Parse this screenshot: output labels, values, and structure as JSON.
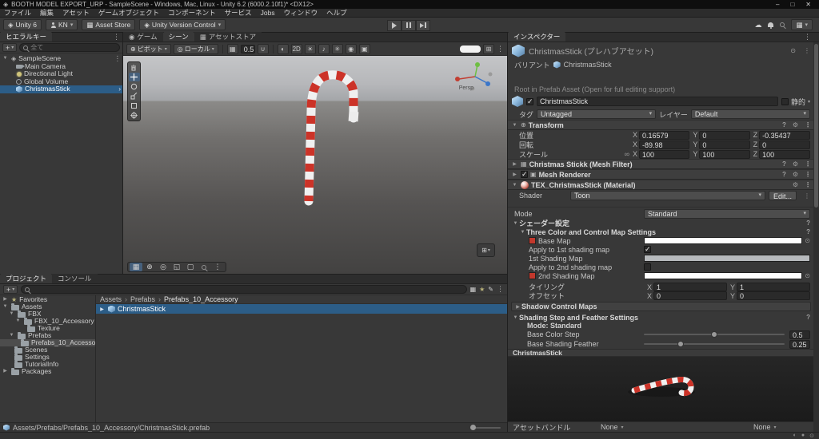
{
  "titlebar": {
    "title": "BOOTH MODEL EXPORT_URP - SampleScene - Windows, Mac, Linux - Unity 6.2 (6000.2.10f1)* <DX12>",
    "minimize": "–",
    "maximize": "□",
    "close": "✕"
  },
  "menubar": {
    "items": [
      "ファイル",
      "編集",
      "アセット",
      "ゲームオブジェクト",
      "コンポーネント",
      "サービス",
      "Jobs",
      "ウィンドウ",
      "ヘルプ"
    ]
  },
  "toolbar": {
    "unity_badge": "Unity 6",
    "account": "KN",
    "asset_store": "Asset Store",
    "version_control": "Unity Version Control"
  },
  "axes": [
    "X",
    "Y",
    "Z"
  ],
  "hierarchy": {
    "tab": "ヒエラルキー",
    "search_placeholder": "全て",
    "scene_name": "SampleScene",
    "items": [
      {
        "label": "Main Camera"
      },
      {
        "label": "Directional Light"
      },
      {
        "label": "Global Volume"
      },
      {
        "label": "ChristmasStick"
      }
    ]
  },
  "scene": {
    "tabs": {
      "game": "ゲーム",
      "scene": "シーン",
      "asset_store": "アセットストア"
    },
    "toolbar": {
      "pivot": "ピボット",
      "handle_rotation": "ローカル",
      "grid_size": "0.5",
      "view_2d": "2D"
    },
    "gizmo_label": "Persp"
  },
  "inspector": {
    "tab": "インスペクター",
    "prefab_title": "ChristmasStick (プレハブアセット)",
    "variant_label": "バリアント",
    "variant_parent": "ChristmasStick",
    "root_note": "Root in Prefab Asset (Open for full editing support)",
    "gameobject": {
      "name": "ChristmasStick",
      "static_label": "静的",
      "tag_label": "タグ",
      "tag": "Untagged",
      "layer_label": "レイヤー",
      "layer": "Default"
    },
    "transform": {
      "title": "Transform",
      "position_label": "位置",
      "rotation_label": "回転",
      "scale_label": "スケール",
      "position": {
        "x": "0.16579",
        "y": "0",
        "z": "-0.35437"
      },
      "rotation": {
        "x": "-89.98",
        "y": "0",
        "z": "0"
      },
      "scale": {
        "x": "100",
        "y": "100",
        "z": "100"
      }
    },
    "mesh_filter_title": "Christmas Stickk (Mesh Filter)",
    "mesh_renderer_title": "Mesh Renderer",
    "material": {
      "title": "TEX_ChristmasStick (Material)",
      "shader_label": "Shader",
      "shader": "Toon",
      "edit_button": "Edit...",
      "mode_label": "Mode",
      "mode": "Standard",
      "shader_settings": "シェーダー設定",
      "three_color_section": "Three Color and Control Map Settings",
      "base_map": "Base Map",
      "apply_1st": "Apply to 1st shading map",
      "first_shading_map": "1st Shading Map",
      "apply_2nd": "Apply to 2nd shading map",
      "second_shading_map": "2nd Shading Map",
      "tiling_label": "タイリング",
      "offset_label": "オフセット",
      "tiling_x": "1",
      "tiling_y": "1",
      "offset_x": "0",
      "offset_y": "0",
      "shadow_section": "Shadow Control Maps",
      "shading_section": "Shading Step and Feather Settings",
      "mode_line": "Mode: Standard",
      "base_color_step_label": "Base Color Step",
      "base_color_step": "0.5",
      "base_shading_feather_label": "Base Shading Feather",
      "base_shading_feather": "0.25"
    },
    "preview_title": "ChristmasStick",
    "assetbundle": {
      "label": "アセットバンドル",
      "bundle": "None",
      "variant": "None"
    }
  },
  "project": {
    "tab_project": "プロジェクト",
    "tab_console": "コンソール",
    "tree": [
      {
        "label": "Favorites"
      },
      {
        "label": "Assets"
      },
      {
        "label": "FBX"
      },
      {
        "label": "FBX_10_Accessory"
      },
      {
        "label": "Texture"
      },
      {
        "label": "Prefabs"
      },
      {
        "label": "Prefabs_10_Accessory"
      },
      {
        "label": "Scenes"
      },
      {
        "label": "Settings"
      },
      {
        "label": "TutorialInfo"
      },
      {
        "label": "Packages"
      }
    ],
    "breadcrumb": [
      "Assets",
      "Prefabs",
      "Prefabs_10_Accessory"
    ],
    "selected_item": "ChristmasStick",
    "footer_path": "Assets/Prefabs/Prefabs_10_Accessory/ChristmasStick.prefab"
  },
  "colors": {
    "selection": "#2c5d87",
    "candy_red": "#cc3328",
    "candy_white": "#f0f0f0"
  }
}
